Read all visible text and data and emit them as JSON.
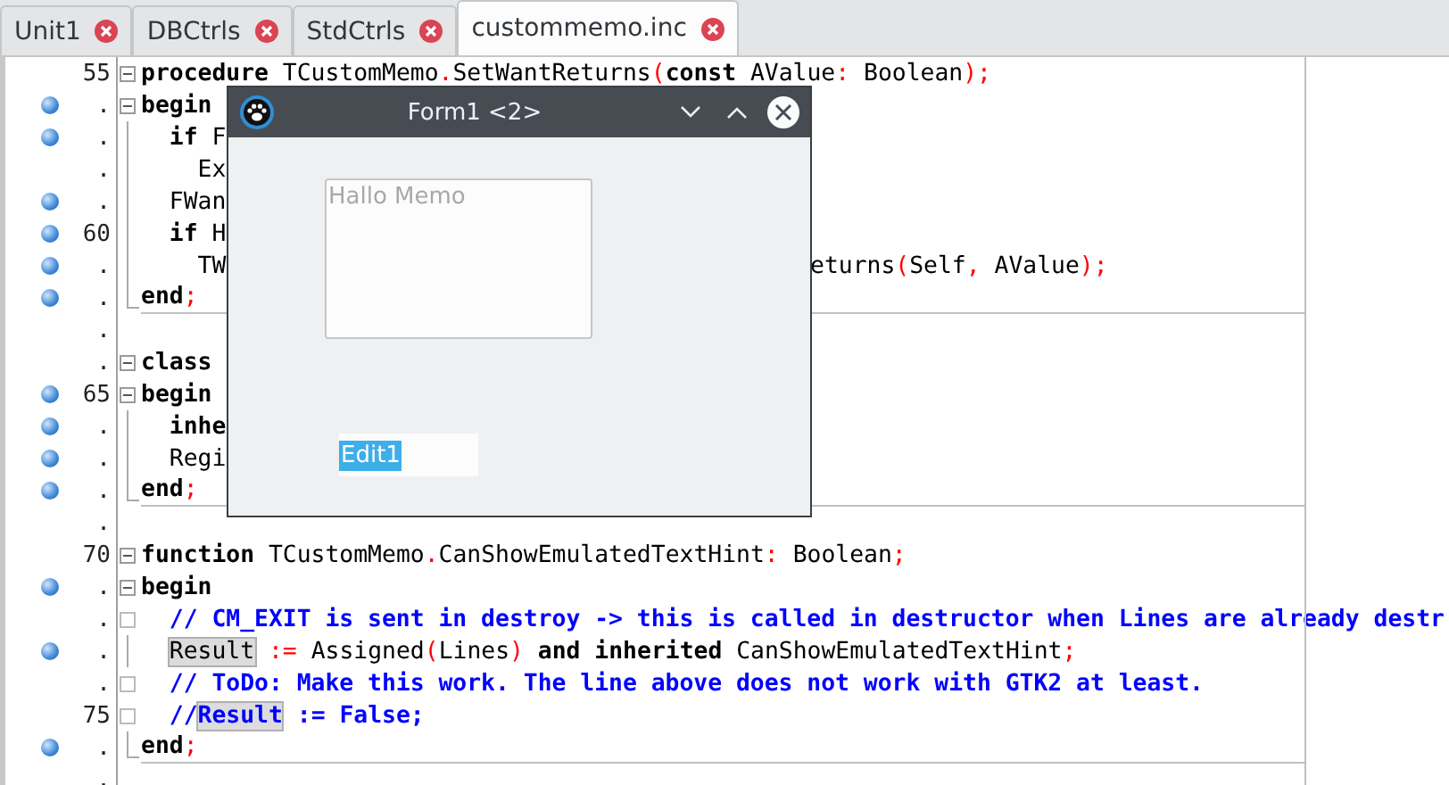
{
  "tabs": [
    {
      "label": "Unit1",
      "selected": false
    },
    {
      "label": "DBCtrls",
      "selected": false
    },
    {
      "label": "StdCtrls",
      "selected": false
    },
    {
      "label": "custommemo.inc",
      "selected": true
    }
  ],
  "lines": [
    {
      "number": "55",
      "dot": false,
      "fold": {
        "kind": "open"
      },
      "head": [
        {
          "kind": "kw",
          "text": "procedure"
        },
        {
          "kind": "id",
          "text": " TCustomMemo"
        },
        {
          "kind": "sym",
          "text": "."
        },
        {
          "kind": "id",
          "text": "SetWantReturns"
        },
        {
          "kind": "sym",
          "text": "("
        },
        {
          "kind": "kw",
          "text": "const"
        },
        {
          "kind": "id",
          "text": " AValue"
        },
        {
          "kind": "sym",
          "text": ":"
        },
        {
          "kind": "id",
          "text": " Boolean"
        },
        {
          "kind": "sym",
          "text": ");"
        }
      ]
    },
    {
      "number": ".",
      "dot": true,
      "fold": {
        "kind": "open"
      },
      "head": [
        {
          "kind": "kw",
          "text": "begin"
        }
      ]
    },
    {
      "number": ".",
      "dot": true,
      "fold": {
        "kind": "line"
      },
      "head": [
        {
          "kind": "kw",
          "text": "  if"
        },
        {
          "kind": "id",
          "text": " F"
        }
      ]
    },
    {
      "number": ".",
      "dot": false,
      "fold": {
        "kind": "line"
      },
      "head": [
        {
          "kind": "id",
          "text": "    Ex"
        }
      ]
    },
    {
      "number": ".",
      "dot": true,
      "fold": {
        "kind": "line"
      },
      "head": [
        {
          "kind": "id",
          "text": "  FWan"
        }
      ]
    },
    {
      "number": "60",
      "dot": true,
      "fold": {
        "kind": "line"
      },
      "head": [
        {
          "kind": "kw",
          "text": "  if"
        },
        {
          "kind": "id",
          "text": " H"
        }
      ]
    },
    {
      "number": ".",
      "dot": true,
      "fold": {
        "kind": "line"
      },
      "head": [
        {
          "kind": "id",
          "text": "    TW"
        }
      ],
      "tail": [
        {
          "kind": "id",
          "text": "eturns"
        },
        {
          "kind": "sym",
          "text": "("
        },
        {
          "kind": "id",
          "text": "Self"
        },
        {
          "kind": "sym",
          "text": ","
        },
        {
          "kind": "id",
          "text": " AValue"
        },
        {
          "kind": "sym",
          "text": ");"
        }
      ]
    },
    {
      "number": ".",
      "dot": true,
      "fold": {
        "kind": "end"
      },
      "divider": true,
      "head": [
        {
          "kind": "kw",
          "text": "end"
        },
        {
          "kind": "sym",
          "text": ";"
        }
      ]
    },
    {
      "number": ".",
      "dot": false
    },
    {
      "number": ".",
      "dot": false,
      "fold": {
        "kind": "open"
      },
      "head": [
        {
          "kind": "kw",
          "text": "class"
        }
      ]
    },
    {
      "number": "65",
      "dot": true,
      "fold": {
        "kind": "open"
      },
      "head": [
        {
          "kind": "kw",
          "text": "begin"
        }
      ]
    },
    {
      "number": ".",
      "dot": true,
      "fold": {
        "kind": "line"
      },
      "head": [
        {
          "kind": "kw",
          "text": "  inhe"
        }
      ]
    },
    {
      "number": ".",
      "dot": true,
      "fold": {
        "kind": "line"
      },
      "head": [
        {
          "kind": "id",
          "text": "  Regi"
        }
      ]
    },
    {
      "number": ".",
      "dot": true,
      "fold": {
        "kind": "end"
      },
      "divider": true,
      "head": [
        {
          "kind": "kw",
          "text": "end"
        },
        {
          "kind": "sym",
          "text": ";"
        }
      ]
    },
    {
      "number": ".",
      "dot": false
    },
    {
      "number": "70",
      "dot": false,
      "fold": {
        "kind": "open"
      },
      "head": [
        {
          "kind": "kw",
          "text": "function"
        },
        {
          "kind": "id",
          "text": " TCustomMemo"
        },
        {
          "kind": "sym",
          "text": "."
        },
        {
          "kind": "id",
          "text": "CanShowEmulatedTextHint"
        },
        {
          "kind": "sym",
          "text": ":"
        },
        {
          "kind": "id",
          "text": " Boolean"
        },
        {
          "kind": "sym",
          "text": ";"
        }
      ]
    },
    {
      "number": ".",
      "dot": true,
      "fold": {
        "kind": "open"
      },
      "head": [
        {
          "kind": "kw",
          "text": "begin"
        }
      ]
    },
    {
      "number": ".",
      "dot": false,
      "fold": {
        "kind": "box"
      },
      "head": [
        {
          "kind": "cm",
          "text": "  // CM_EXIT is sent in destroy -> this is called in destructor when Lines are already destr"
        }
      ]
    },
    {
      "number": ".",
      "dot": true,
      "fold": {
        "kind": "line"
      },
      "head": [
        {
          "kind": "hl",
          "text": "  Result"
        },
        {
          "kind": "sym",
          "text": " :="
        },
        {
          "kind": "id",
          "text": " Assigned"
        },
        {
          "kind": "sym",
          "text": "("
        },
        {
          "kind": "id",
          "text": "Lines"
        },
        {
          "kind": "sym",
          "text": ")"
        },
        {
          "kind": "kw",
          "text": " and inherited"
        },
        {
          "kind": "id",
          "text": " CanShowEmulatedTextHint"
        },
        {
          "kind": "sym",
          "text": ";"
        }
      ]
    },
    {
      "number": ".",
      "dot": false,
      "fold": {
        "kind": "box"
      },
      "head": [
        {
          "kind": "cm",
          "text": "  // ToDo: Make this work. The line above does not work with GTK2 at least."
        }
      ]
    },
    {
      "number": "75",
      "dot": false,
      "fold": {
        "kind": "box"
      },
      "head": [
        {
          "kind": "cm",
          "text": "  //"
        },
        {
          "kind": "cmhl",
          "text": "Result"
        },
        {
          "kind": "cm",
          "text": " := False;"
        }
      ]
    },
    {
      "number": ".",
      "dot": true,
      "fold": {
        "kind": "end"
      },
      "divider": true,
      "head": [
        {
          "kind": "kw",
          "text": "end"
        },
        {
          "kind": "sym",
          "text": ";"
        }
      ]
    },
    {
      "number": ".",
      "dot": false
    }
  ],
  "form": {
    "title": "Form1 <2>",
    "memo": {
      "placeholder": "Hallo Memo"
    },
    "edit": {
      "value": "Edit1",
      "selected": true
    }
  }
}
